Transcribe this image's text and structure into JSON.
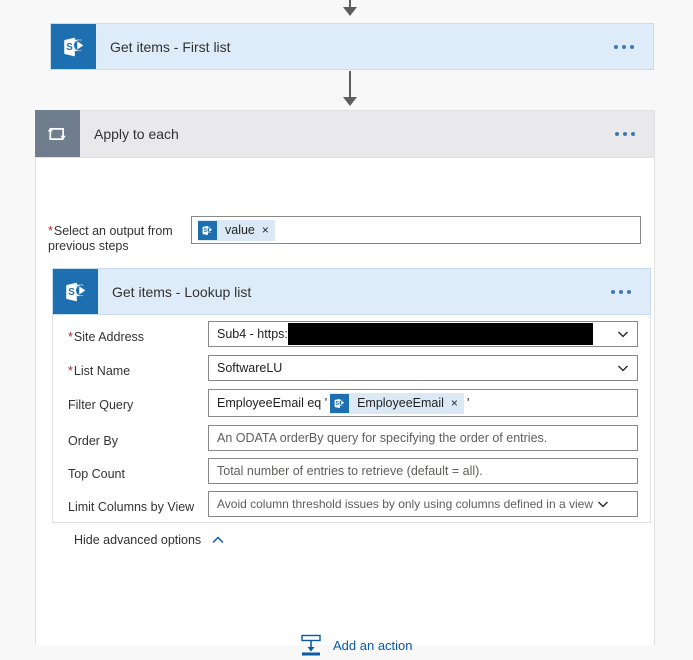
{
  "flow": {
    "steps": [
      {
        "id": "get-items-first-list",
        "title": "Get items - First list",
        "icon": "sharepoint-icon",
        "menu": "more-commands"
      },
      {
        "id": "apply-to-each",
        "title": "Apply to each",
        "icon": "loop-icon",
        "menu": "more-commands"
      },
      {
        "id": "get-items-lookup-list",
        "title": "Get items - Lookup list",
        "icon": "sharepoint-icon",
        "menu": "more-commands"
      }
    ]
  },
  "apply_to_each": {
    "output_field": {
      "label": "Select an output from previous steps",
      "required": true,
      "token": {
        "label": "value",
        "icon": "sharepoint-icon",
        "remove": "×"
      }
    }
  },
  "lookup_action": {
    "fields": [
      {
        "id": "site-address",
        "label": "Site Address",
        "required": true,
        "type": "dropdown",
        "value": "Sub4 - https:",
        "redacted": true
      },
      {
        "id": "list-name",
        "label": "List Name",
        "required": true,
        "type": "dropdown",
        "value": "SoftwareLU"
      },
      {
        "id": "filter-query",
        "label": "Filter Query",
        "required": false,
        "type": "token-text",
        "prefix": "EmployeeEmail eq '",
        "token": {
          "label": "EmployeeEmail",
          "icon": "sharepoint-icon",
          "remove": "×"
        },
        "suffix": "'"
      },
      {
        "id": "order-by",
        "label": "Order By",
        "required": false,
        "type": "text",
        "value": "",
        "placeholder": "An ODATA orderBy query for specifying the order of entries."
      },
      {
        "id": "top-count",
        "label": "Top Count",
        "required": false,
        "type": "text",
        "value": "",
        "placeholder": "Total number of entries to retrieve (default = all)."
      },
      {
        "id": "limit-columns-by-view",
        "label": "Limit Columns by View",
        "required": false,
        "type": "dropdown",
        "value": "",
        "placeholder": "Avoid column threshold issues by only using columns defined in a view"
      }
    ],
    "advanced_toggle": {
      "label": "Hide advanced options",
      "icon": "chevron-up-icon"
    }
  },
  "footer": {
    "add_action": {
      "label": "Add an action",
      "icon": "add-action-icon"
    }
  },
  "colors": {
    "card_background": "#deecf9",
    "scope_header": "#e9e9ec",
    "sharepoint_blue": "#1d6fb0",
    "loop_gray": "#6f7d8c",
    "link_blue": "#0b5aa2",
    "required_red": "#a4262c",
    "page_background": "#f8f8f8"
  }
}
